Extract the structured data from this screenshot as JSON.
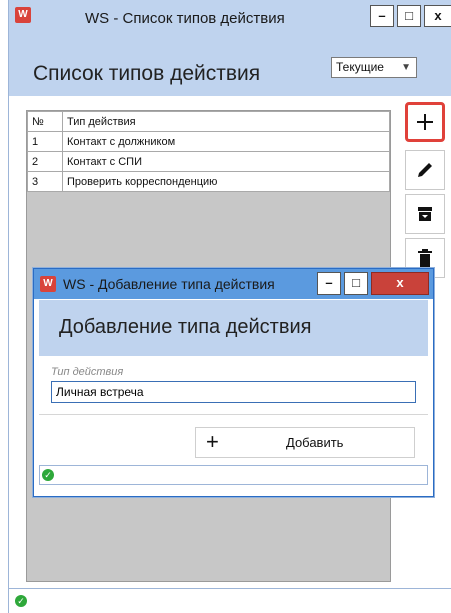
{
  "main_window": {
    "app_icon": "W",
    "title": "WS - Список типов действия",
    "minimize": "–",
    "maximize": "□",
    "close": "x",
    "heading": "Список типов действия",
    "filter": {
      "selected": "Текущие"
    },
    "table": {
      "headers": [
        "№",
        "Тип действия"
      ],
      "rows": [
        [
          "1",
          "Контакт с должником"
        ],
        [
          "2",
          "Контакт с СПИ"
        ],
        [
          "3",
          "Проверить корреспонденцию"
        ]
      ]
    },
    "toolbar": {
      "add_icon": "plus-icon",
      "edit_icon": "pencil-icon",
      "archive_icon": "archive-icon",
      "delete_icon": "trash-icon",
      "highlight_color": "#e0413a"
    },
    "status_icon": "check-circle-icon"
  },
  "dialog": {
    "app_icon": "W",
    "title": "WS - Добавление типа действия",
    "minimize": "–",
    "maximize": "□",
    "close": "x",
    "heading": "Добавление типа действия",
    "field_label": "Тип действия",
    "field_value": "Личная встреча",
    "add_symbol": "+",
    "add_label": "Добавить",
    "status_icon": "check-circle-icon"
  },
  "colors": {
    "header_bg": "#bfd3ee",
    "dialog_titlebar": "#5b9adf",
    "close_red": "#c9423a",
    "ok_green": "#2ea83a"
  }
}
